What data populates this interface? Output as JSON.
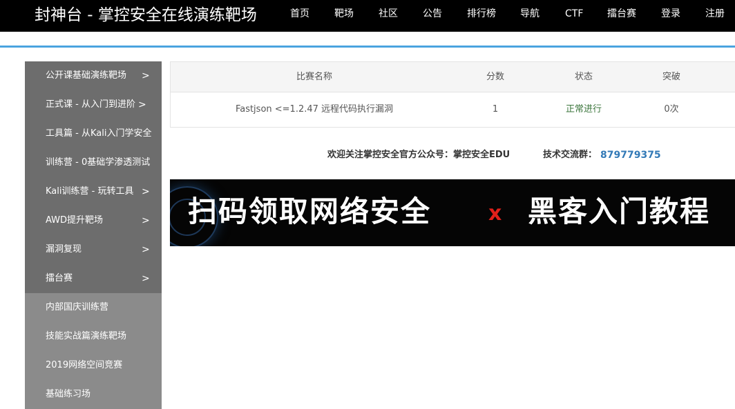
{
  "header": {
    "brand": "封神台 - 掌控安全在线演练靶场",
    "nav": [
      "首页",
      "靶场",
      "社区",
      "公告",
      "排行榜",
      "导航",
      "CTF",
      "擂台赛",
      "登录",
      "注册"
    ]
  },
  "sidebar": {
    "items": [
      {
        "label": "公开课基础演练靶场",
        "arrow": ">"
      },
      {
        "label": "正式课 - 从入门到进阶",
        "arrow": ">"
      },
      {
        "label": "工具篇 - 从Kali入门学安全",
        "arrow": ""
      },
      {
        "label": "训练营 - 0基础学渗透测试",
        "arrow": ""
      },
      {
        "label": "Kali训练营 - 玩转工具",
        "arrow": ">"
      },
      {
        "label": "AWD提升靶场",
        "arrow": ">"
      },
      {
        "label": "漏洞复现",
        "arrow": ">"
      },
      {
        "label": "擂台赛",
        "arrow": ">"
      }
    ],
    "sub_items": [
      "内部国庆训练营",
      "技能实战篇演练靶场",
      "2019网络空间竞赛",
      "基础练习场"
    ]
  },
  "table": {
    "headers": [
      "比赛名称",
      "分数",
      "状态",
      "突破"
    ],
    "rows": [
      [
        "Fastjson <=1.2.47 远程代码执行漏洞",
        "1",
        "正常进行",
        "0次"
      ]
    ]
  },
  "follow": {
    "text": "欢迎关注掌控安全官方公众号：掌控安全EDU",
    "group_label": "技术交流群：",
    "group_number": "879779375"
  },
  "banner": {
    "text_left": "扫码领取网络安全",
    "x_mark": "x",
    "text_right": "黑客入门教程"
  },
  "colors": {
    "topbar": "#000000",
    "accent_line": "#4aa3df",
    "sidebar_dark": "#6d6d6d",
    "sidebar_light": "#8b8b8b",
    "status_ok": "#3c763d",
    "link_blue": "#337ab7",
    "banner_x": "#e0201a"
  }
}
